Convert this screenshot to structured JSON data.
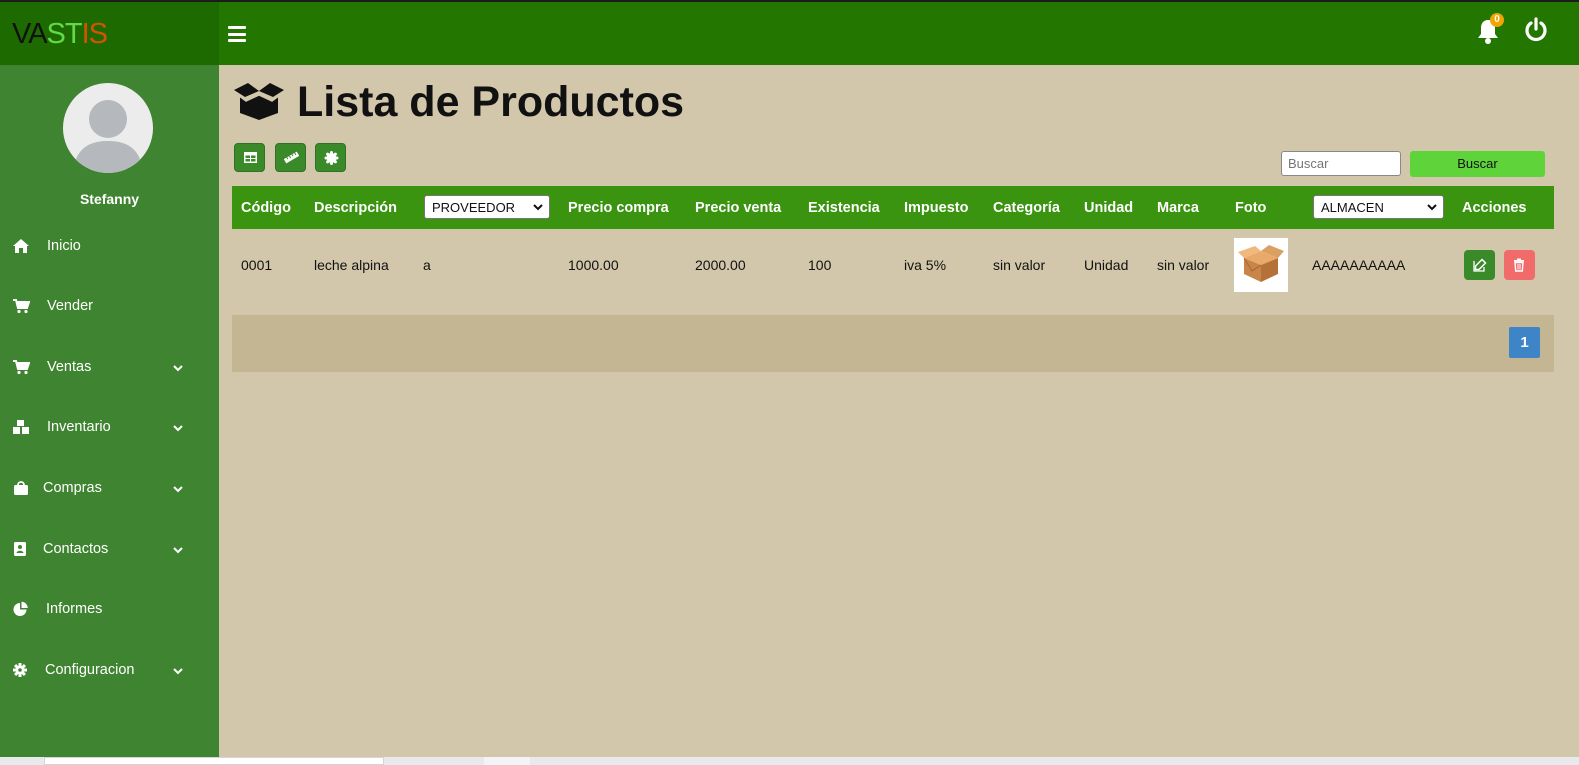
{
  "brand": {
    "logo_parts": [
      "VA",
      "ST",
      "IS"
    ],
    "logo_colors": [
      "#111111",
      "#62d948",
      "#d35400"
    ]
  },
  "topbar": {
    "notifications_count": "0"
  },
  "sidebar": {
    "username": "Stefanny",
    "items": [
      {
        "label": "Inicio",
        "icon": "home-icon",
        "has_submenu": false
      },
      {
        "label": "Vender",
        "icon": "cart-icon",
        "has_submenu": false
      },
      {
        "label": "Ventas",
        "icon": "cart-icon",
        "has_submenu": true
      },
      {
        "label": "Inventario",
        "icon": "boxes-icon",
        "has_submenu": true
      },
      {
        "label": "Compras",
        "icon": "shopping-bag-icon",
        "has_submenu": true
      },
      {
        "label": "Contactos",
        "icon": "address-book-icon",
        "has_submenu": true
      },
      {
        "label": "Informes",
        "icon": "pie-chart-icon",
        "has_submenu": false
      },
      {
        "label": "Configuracion",
        "icon": "gear-icon",
        "has_submenu": true
      }
    ]
  },
  "main": {
    "title": "Lista de Productos",
    "toolbar": [
      "table-view-icon",
      "ruler-icon",
      "badge-icon"
    ],
    "search": {
      "placeholder": "Buscar",
      "button_label": "Buscar"
    }
  },
  "table": {
    "headers": {
      "codigo": "Código",
      "descripcion": "Descripción",
      "proveedor_select": "PROVEEDOR",
      "precio_compra": "Precio compra",
      "precio_venta": "Precio venta",
      "existencia": "Existencia",
      "impuesto": "Impuesto",
      "categoria": "Categoría",
      "unidad": "Unidad",
      "marca": "Marca",
      "foto": "Foto",
      "almacen_select": "ALMACEN",
      "acciones": "Acciones"
    },
    "rows": [
      {
        "codigo": "0001",
        "descripcion": "leche alpina",
        "proveedor": "a",
        "precio_compra": "1000.00",
        "precio_venta": "2000.00",
        "existencia": "100",
        "impuesto": "iva 5%",
        "categoria": "sin valor",
        "unidad": "Unidad",
        "marca": "sin valor",
        "foto": "box-image",
        "almacen": "AAAAAAAAAA"
      }
    ]
  },
  "pagination": {
    "current_page": "1"
  },
  "colors": {
    "header_green": "#237700",
    "sidebar_green": "#3f8430",
    "table_header": "#3a9410",
    "background": "#d3c7ab",
    "delete_red": "#f26b6b",
    "page_blue": "#3d85c6"
  }
}
